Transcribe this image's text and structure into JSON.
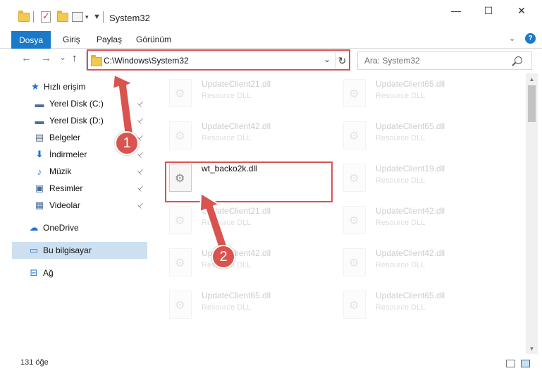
{
  "window": {
    "title": "System32",
    "minimize_glyph": "—",
    "maximize_glyph": "☐",
    "close_glyph": "✕"
  },
  "ribbon": {
    "file_tab": "Dosya",
    "tabs": [
      "Giriş",
      "Paylaş",
      "Görünüm"
    ],
    "expand_glyph": "⌄",
    "help_glyph": "?"
  },
  "address": {
    "path": "C:\\Windows\\System32",
    "back_glyph": "←",
    "forward_glyph": "→",
    "recent_glyph": "⌄",
    "up_glyph": "↑",
    "dropdown_glyph": "⌄",
    "refresh_glyph": "↻"
  },
  "search": {
    "placeholder": "Ara: System32"
  },
  "sidebar": {
    "items": [
      {
        "label": "Hızlı erişim",
        "icon": "star-icon",
        "glyph": "★",
        "color": "#1a73d4",
        "pinned": false
      },
      {
        "label": "Yerel Disk (C:)",
        "icon": "drive-icon",
        "glyph": "▬",
        "color": "#4a6f9a",
        "pinned": true
      },
      {
        "label": "Yerel Disk (D:)",
        "icon": "drive-icon",
        "glyph": "▬",
        "color": "#4a6f9a",
        "pinned": true
      },
      {
        "label": "Belgeler",
        "icon": "documents-icon",
        "glyph": "▤",
        "color": "#5a6c80",
        "pinned": true
      },
      {
        "label": "İndirmeler",
        "icon": "download-icon",
        "glyph": "⬇",
        "color": "#1a73d4",
        "pinned": true
      },
      {
        "label": "Müzik",
        "icon": "music-icon",
        "glyph": "♪",
        "color": "#1a73d4",
        "pinned": true
      },
      {
        "label": "Resimler",
        "icon": "pictures-icon",
        "glyph": "▣",
        "color": "#4a6f9a",
        "pinned": true
      },
      {
        "label": "Videolar",
        "icon": "video-icon",
        "glyph": "▦",
        "color": "#4a6f9a",
        "pinned": true
      },
      {
        "label": "OneDrive",
        "icon": "cloud-icon",
        "glyph": "☁",
        "color": "#1a73d4",
        "pinned": false
      },
      {
        "label": "Bu bilgisayar",
        "icon": "computer-icon",
        "glyph": "▭",
        "color": "#1a73d4",
        "pinned": false
      },
      {
        "label": "Ağ",
        "icon": "network-icon",
        "glyph": "⊟",
        "color": "#1a73d4",
        "pinned": false
      }
    ],
    "pin_glyph": "📌"
  },
  "files": [
    {
      "name": "UpdateClient21.dll",
      "type": "Resource DLL"
    },
    {
      "name": "UpdateClient65.dll",
      "type": "Resource DLL"
    },
    {
      "name": "UpdateClient42.dll",
      "type": "Resource DLL"
    },
    {
      "name": "UpdateClient65.dll",
      "type": "Resource DLL"
    },
    {
      "name": "wt_backo2k.dll",
      "type": ""
    },
    {
      "name": "UpdateClient19.dll",
      "type": "Resource DLL"
    },
    {
      "name": "UpdateClient21.dll",
      "type": "Resource DLL"
    },
    {
      "name": "UpdateClient42.dll",
      "type": "Resource DLL"
    },
    {
      "name": "UpdateClient42.dll",
      "type": "Resource DLL"
    },
    {
      "name": "UpdateClient42.dll",
      "type": "Resource DLL"
    },
    {
      "name": "UpdateClient65.dll",
      "type": "Resource DLL"
    },
    {
      "name": "UpdateClient65.dll",
      "type": "Resource DLL"
    }
  ],
  "status": {
    "item_count": "131 öğe"
  },
  "annotations": {
    "step1": "1",
    "step2": "2",
    "color": "#d9534f"
  }
}
